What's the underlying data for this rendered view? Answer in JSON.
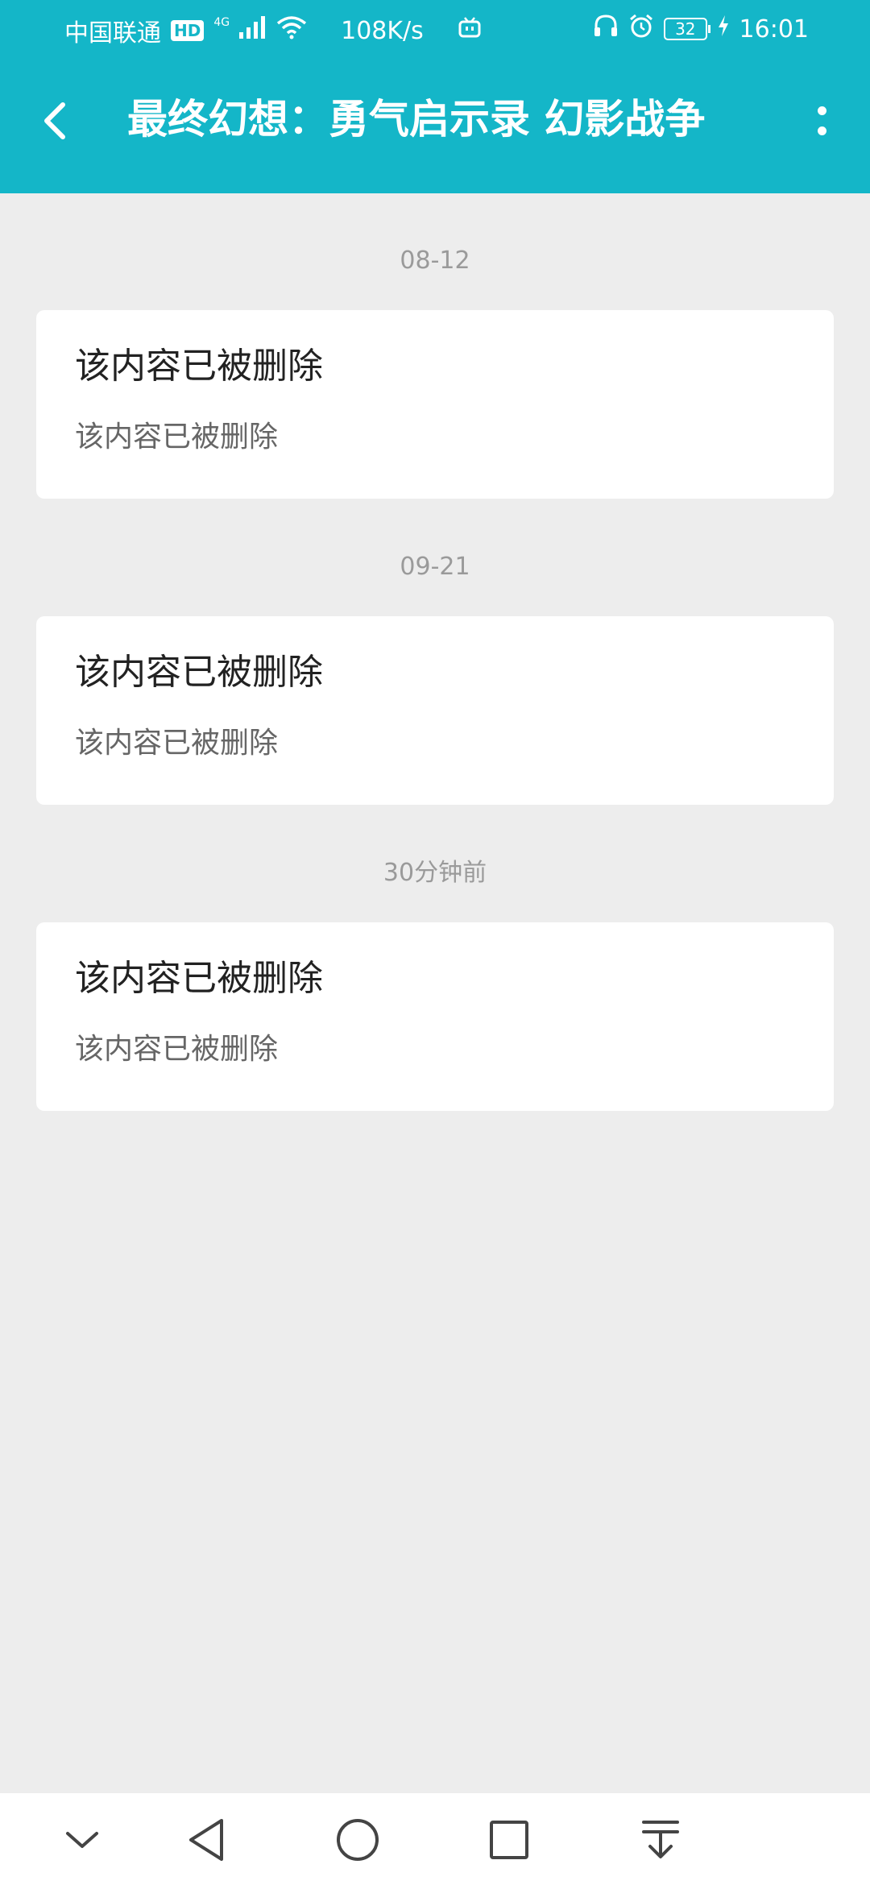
{
  "status_bar": {
    "carrier": "中国联通",
    "hd_badge": "HD",
    "network_type": "4G",
    "net_speed": "108K/s",
    "battery": "32",
    "time": "16:01",
    "icons": [
      "signal-icon",
      "wifi-icon",
      "tv-icon",
      "headphones-icon",
      "alarm-icon",
      "charging-icon"
    ]
  },
  "toolbar": {
    "title": "最终幻想：勇气启示录 幻影战争",
    "back_icon": "chevron-left-icon",
    "more_icon": "more-vertical-icon"
  },
  "feed": [
    {
      "date": "08-12",
      "title": "该内容已被删除",
      "body": "该内容已被删除"
    },
    {
      "date": "09-21",
      "title": "该内容已被删除",
      "body": "该内容已被删除"
    },
    {
      "date": "30分钟前",
      "title": "该内容已被删除",
      "body": "该内容已被删除"
    }
  ],
  "nav_bar": {
    "icons": [
      "chevron-down-icon",
      "back-triangle-icon",
      "home-circle-icon",
      "recents-square-icon",
      "pull-down-icon"
    ]
  },
  "colors": {
    "accent": "#14b6c8",
    "background": "#ededed",
    "card": "#ffffff",
    "title_text": "#222222",
    "body_text": "#666666",
    "date_text": "#9a9a9a"
  }
}
